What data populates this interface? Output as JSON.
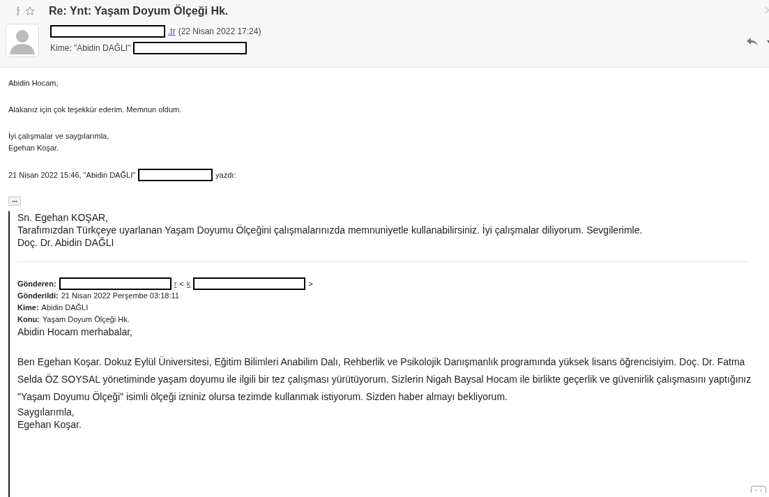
{
  "header": {
    "subject": "Re: Ynt: Yaşam Doyum Ölçeği Hk.",
    "sender_tail": ".tr",
    "date": "(22 Nisan 2022 17:24)",
    "to_label": "Kime: \"Abidin DAĞLI\""
  },
  "reply": {
    "paragraphs": [
      [
        "Abidin Hocam,"
      ],
      [
        "Alakanız için çok teşekkür ederim. Memnun oldum."
      ],
      [
        "İyi çalışmalar ve saygılarımla,",
        "Egehan Koşar."
      ]
    ],
    "attribution": "21 Nisan 2022 15:46, \"Abidin DAĞLI\"",
    "attribution_tail": "yazdı:",
    "expand_button": "•••"
  },
  "quote": {
    "lines": [
      "Sn. Egehan KOŞAR,",
      "Tarafımızdan Türkçeye uyarlanan Yaşam Doyumu Ölçeğini çalışmalarınızda memnuniyetle kullanabilirsiniz. İyi çalışmalar diliyorum. Sevgilerimle.",
      "Doç. Dr. Abidin DAĞLI"
    ],
    "from_label": "Gönderen:",
    "from_link_a": "r",
    "from_lt": "<",
    "from_link_b": "k",
    "from_gt": ">",
    "fields": [
      {
        "label": "Gönderildi:",
        "value": "21 Nisan 2022 Perşembe 03:18:11"
      },
      {
        "label": "Kime:",
        "value": "Abidin DAĞLI"
      },
      {
        "label": "Konu:",
        "value": "Yaşam Doyum Ölçeği Hk."
      }
    ],
    "greeting": "Abidin Hocam merhabalar,",
    "body": "Ben Egehan Koşar. Dokuz Eylül Üniversitesi, Eğitim Bilimleri Anabilim Dalı, Rehberlik ve Psikolojik Danışmanlık programında yüksek lisans öğrencisiyim. Doç. Dr. Fatma Selda ÖZ SOYSAL yönetiminde yaşam doyumu ile ilgili bir tez çalışması yürütüyorum. Sizlerin Nigah Baysal Hocam ile birlikte geçerlik ve güvenirlik çalışmasını yaptığınız \"Yaşam Doyumu Ölçeği\" isimli ölçeği izniniz olursa tezimde kullanmak istiyorum. Sizden haber almayı bekliyorum.",
    "closing": [
      "Saygılarımla,",
      "Egehan Koşar."
    ]
  }
}
